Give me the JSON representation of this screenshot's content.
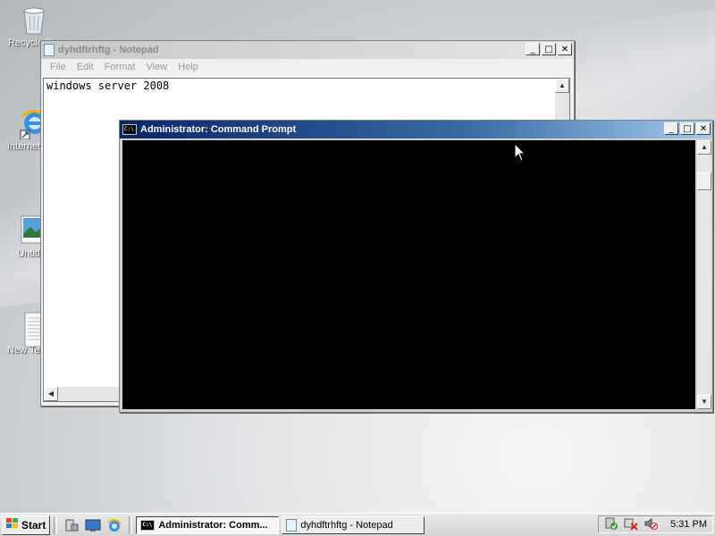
{
  "desktop": {
    "icons": [
      {
        "label": "Recycle Bin"
      },
      {
        "label": "Internet Explorer"
      },
      {
        "label": "Untitled"
      },
      {
        "label": "New Text Document"
      }
    ]
  },
  "notepad": {
    "title": "dyhdftrhftg - Notepad",
    "menu": [
      "File",
      "Edit",
      "Format",
      "View",
      "Help"
    ],
    "content": "windows server 2008"
  },
  "cmd": {
    "title": "Administrator: Command Prompt",
    "icon_text": "C:\\"
  },
  "window_controls": {
    "minimize": "_",
    "maximize": "□",
    "close": "✕"
  },
  "taskbar": {
    "start_label": "Start",
    "tasks": [
      {
        "label": "Administrator: Comm...",
        "active": true
      },
      {
        "label": "dyhdftrhftg - Notepad",
        "active": false
      }
    ],
    "clock": "5:31 PM"
  },
  "colors": {
    "cmd_title_active": "#0a246a",
    "cmd_bg": "#000000",
    "inactive_title": "#c9c9c9"
  }
}
